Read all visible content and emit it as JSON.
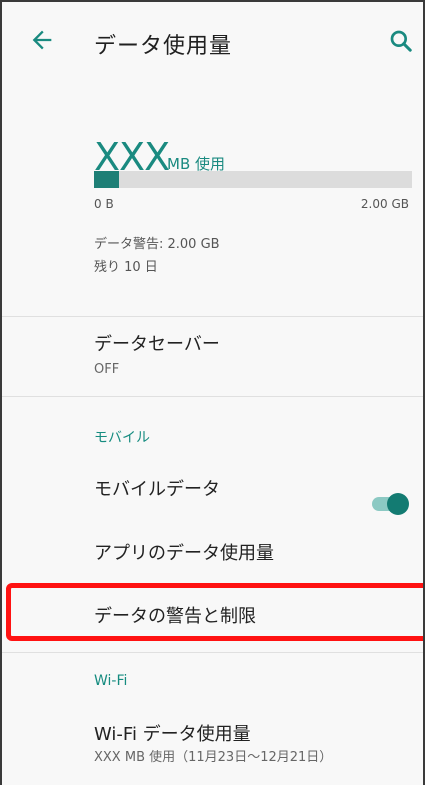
{
  "header": {
    "title": "データ使用量",
    "back_icon": "back-arrow-icon",
    "search_icon": "search-icon"
  },
  "usage": {
    "amount": "XXX",
    "unit": "MB 使用",
    "bar_min": "0 B",
    "bar_max": "2.00 GB",
    "fill_fraction": 0.08,
    "warning": "データ警告: 2.00 GB",
    "remaining": "残り 10 日"
  },
  "data_saver": {
    "label": "データセーバー",
    "status": "OFF"
  },
  "mobile": {
    "section_title": "モバイル",
    "mobile_data_label": "モバイルデータ",
    "mobile_data_enabled": true,
    "app_usage_label": "アプリのデータ使用量",
    "warning_limit_label": "データの警告と制限"
  },
  "wifi": {
    "section_title": "Wi-Fi",
    "usage_label": "Wi-Fi データ使用量",
    "usage_detail": "XXX MB 使用（11月23日〜12月21日）"
  },
  "colors": {
    "accent": "#1a8a80",
    "bar_fill": "#1e7f76",
    "highlight": "#ff1212"
  }
}
